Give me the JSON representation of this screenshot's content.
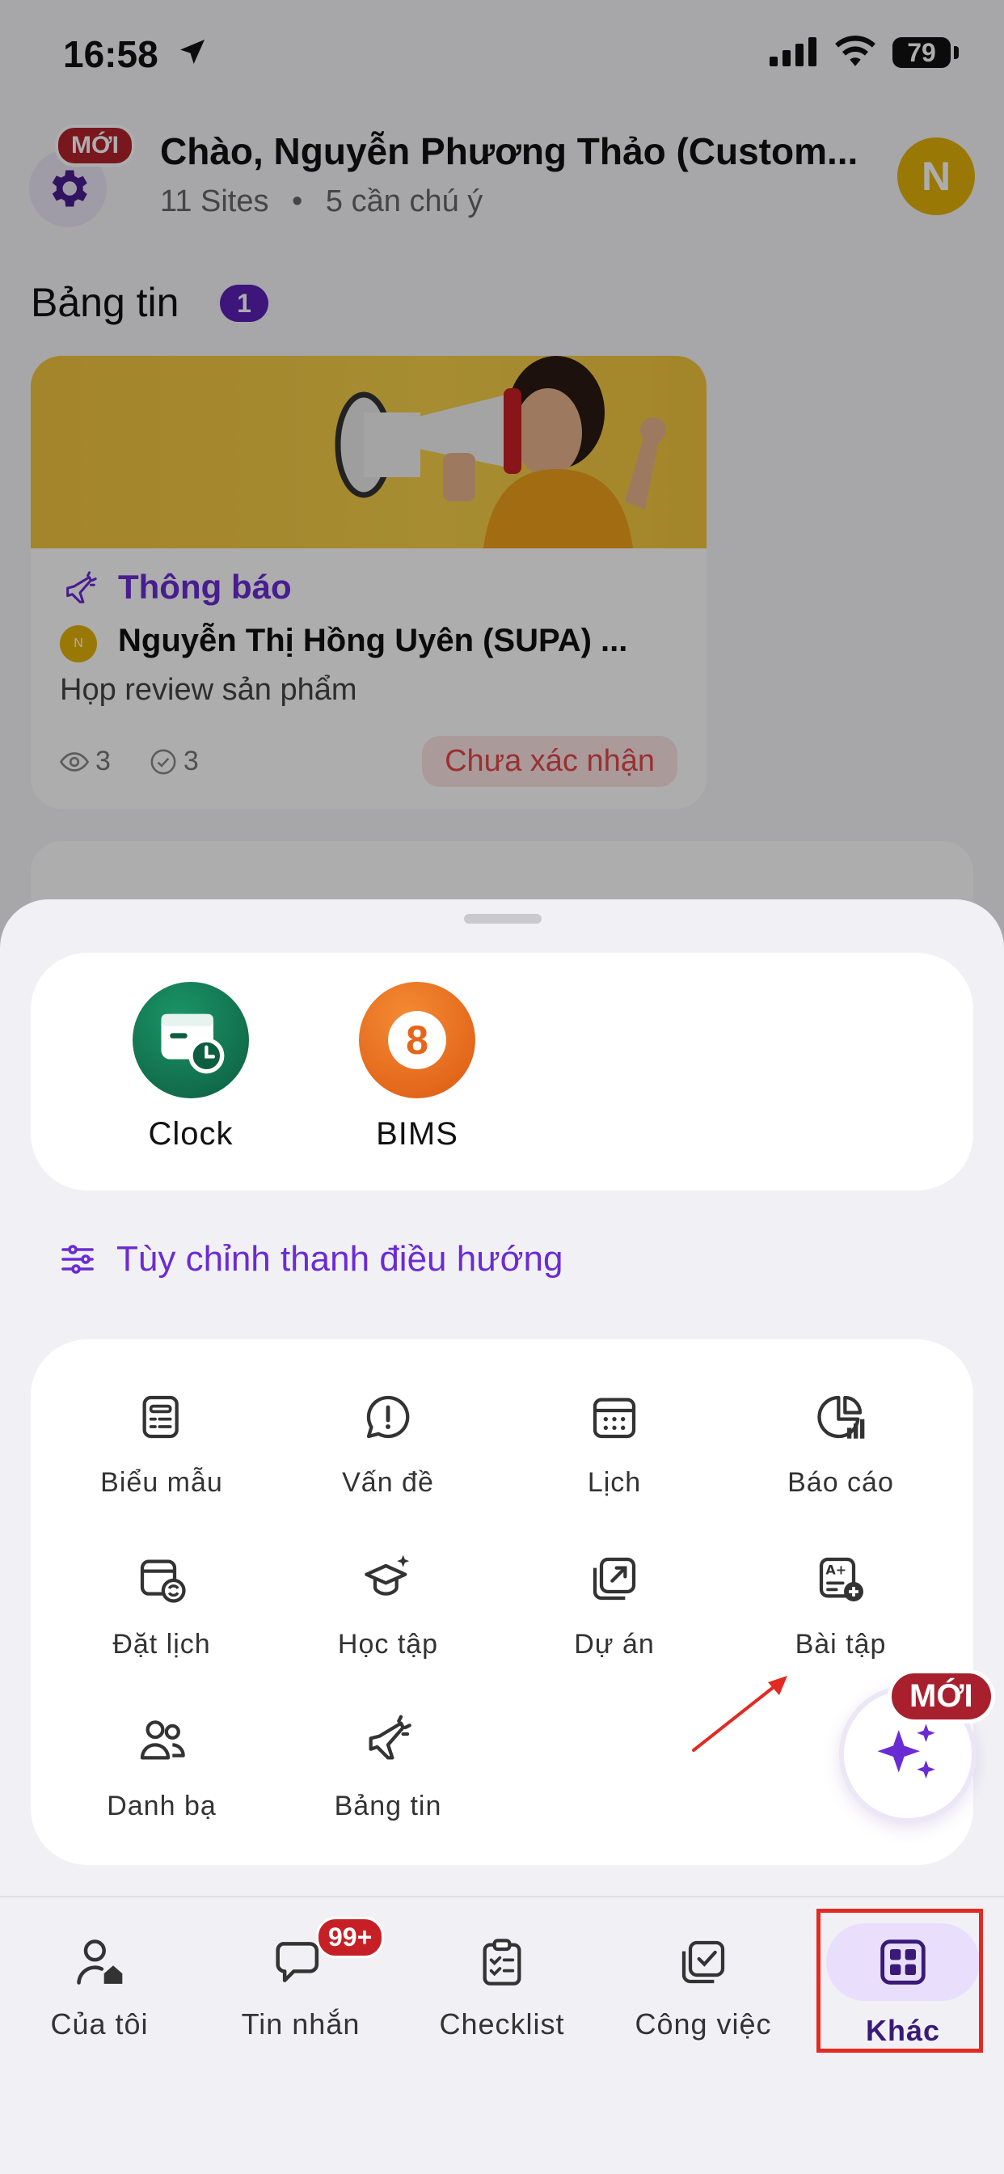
{
  "status_bar": {
    "time": "16:58",
    "battery": "79"
  },
  "header": {
    "new_badge": "MỚI",
    "greeting": "Chào, Nguyễn Phương Thảo (Custom...",
    "sites": "11 Sites",
    "separator": "•",
    "attention": "5 cần chú ý",
    "avatar_initial": "N"
  },
  "feed": {
    "title": "Bảng tin",
    "count": "1",
    "card": {
      "type": "Thông báo",
      "author": "Nguyễn Thị Hồng Uyên (SUPA) ...",
      "author_initial": "N",
      "description": "Họp review sản phẩm",
      "views": "3",
      "confirms": "3",
      "status": "Chưa xác nhận"
    }
  },
  "sheet": {
    "apps": [
      {
        "label": "Clock",
        "icon": "clock-app-icon",
        "color": "#12714e"
      },
      {
        "label": "BIMS",
        "icon": "bims-app-icon",
        "color": "#ec6a1c",
        "glyph": "8"
      }
    ],
    "customize_label": "Tùy chỉnh thanh điều hướng",
    "features": [
      {
        "label": "Biểu mẫu",
        "icon": "form-icon"
      },
      {
        "label": "Vấn đề",
        "icon": "issue-icon"
      },
      {
        "label": "Lịch",
        "icon": "calendar-icon"
      },
      {
        "label": "Báo cáo",
        "icon": "report-icon"
      },
      {
        "label": "Đặt lịch",
        "icon": "schedule-icon"
      },
      {
        "label": "Học tập",
        "icon": "learning-icon"
      },
      {
        "label": "Dự án",
        "icon": "project-icon"
      },
      {
        "label": "Bài tập",
        "icon": "assignment-icon"
      },
      {
        "label": "Danh bạ",
        "icon": "contacts-icon"
      },
      {
        "label": "Bảng tin",
        "icon": "newsfeed-icon"
      }
    ],
    "ai_new_badge": "MỚI"
  },
  "tabbar": {
    "tabs": [
      {
        "label": "Của tôi",
        "icon": "user-home-icon"
      },
      {
        "label": "Tin nhắn",
        "icon": "chat-icon",
        "badge": "99+"
      },
      {
        "label": "Checklist",
        "icon": "checklist-icon"
      },
      {
        "label": "Công việc",
        "icon": "task-icon"
      },
      {
        "label": "Khác",
        "icon": "grid-icon",
        "active": true
      }
    ]
  },
  "colors": {
    "accent": "#6b2bd4",
    "highlight_box": "#e22a22",
    "badge_red": "#c62026"
  }
}
